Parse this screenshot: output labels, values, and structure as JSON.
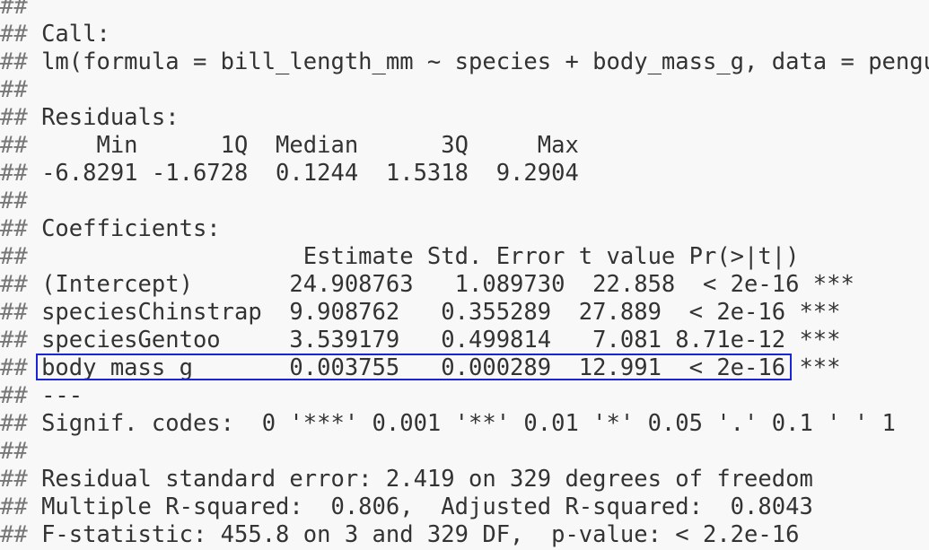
{
  "console": {
    "prefix": "##",
    "lines": [
      "",
      " Call:",
      " lm(formula = bill_length_mm ~ species + body_mass_g, data = pengu",
      "",
      " Residuals:",
      "     Min      1Q  Median      3Q     Max ",
      " -6.8291 -1.6728  0.1244  1.5318  9.2904 ",
      "",
      " Coefficients:",
      "                    Estimate Std. Error t value Pr(>|t|)    ",
      " (Intercept)       24.908763   1.089730  22.858  < 2e-16 ***",
      " speciesChinstrap  9.908762   0.355289  27.889  < 2e-16 ***",
      " speciesGentoo     3.539179   0.499814   7.081 8.71e-12 ***",
      " body_mass_g       0.003755   0.000289  12.991  < 2e-16 ***",
      " ---",
      " Signif. codes:  0 '***' 0.001 '**' 0.01 '*' 0.05 '.' 0.1 ' ' 1",
      "",
      " Residual standard error: 2.419 on 329 degrees of freedom",
      " Multiple R-squared:  0.806,\tAdjusted R-squared:  0.8043 ",
      " F-statistic: 455.8 on 3 and 329 DF,  p-value: < 2.2e-16"
    ]
  },
  "highlight": {
    "row": "body_mass_g",
    "color": "#1a25d6"
  }
}
